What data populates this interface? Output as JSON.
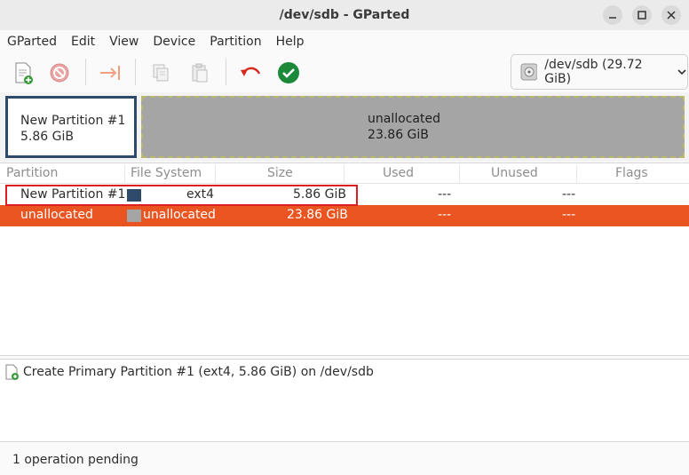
{
  "window": {
    "title": "/dev/sdb - GParted"
  },
  "menu": [
    "GParted",
    "Edit",
    "View",
    "Device",
    "Partition",
    "Help"
  ],
  "toolbar": {
    "icons": [
      "new-partition-icon",
      "delete-icon",
      "resize-move-icon",
      "copy-icon",
      "paste-icon",
      "undo-icon",
      "apply-icon"
    ]
  },
  "device": {
    "label": "/dev/sdb (29.72 GiB)"
  },
  "partition_map": {
    "new": {
      "name": "New Partition #1",
      "size": "5.86 GiB"
    },
    "unallocated": {
      "name": "unallocated",
      "size": "23.86 GiB"
    }
  },
  "table": {
    "headers": [
      "Partition",
      "File System",
      "Size",
      "Used",
      "Unused",
      "Flags"
    ],
    "rows": [
      {
        "partition": "New Partition #1",
        "filesystem": "ext4",
        "size": "5.86 GiB",
        "used": "---",
        "unused": "---",
        "flags": "",
        "color": "#2e4a6b"
      },
      {
        "partition": "unallocated",
        "filesystem": "unallocated",
        "size": "23.86 GiB",
        "used": "---",
        "unused": "---",
        "flags": "",
        "color": "#a5a5a5"
      }
    ]
  },
  "operations": [
    {
      "text": "Create Primary Partition #1 (ext4, 5.86 GiB) on /dev/sdb"
    }
  ],
  "status": {
    "text": "1 operation pending"
  },
  "colors": {
    "accent": "#e95420",
    "partition_border": "#2e4a6b",
    "apply_green": "#1a8a3a",
    "undo_red": "#d62a20",
    "highlight": "#dd1f1f"
  }
}
